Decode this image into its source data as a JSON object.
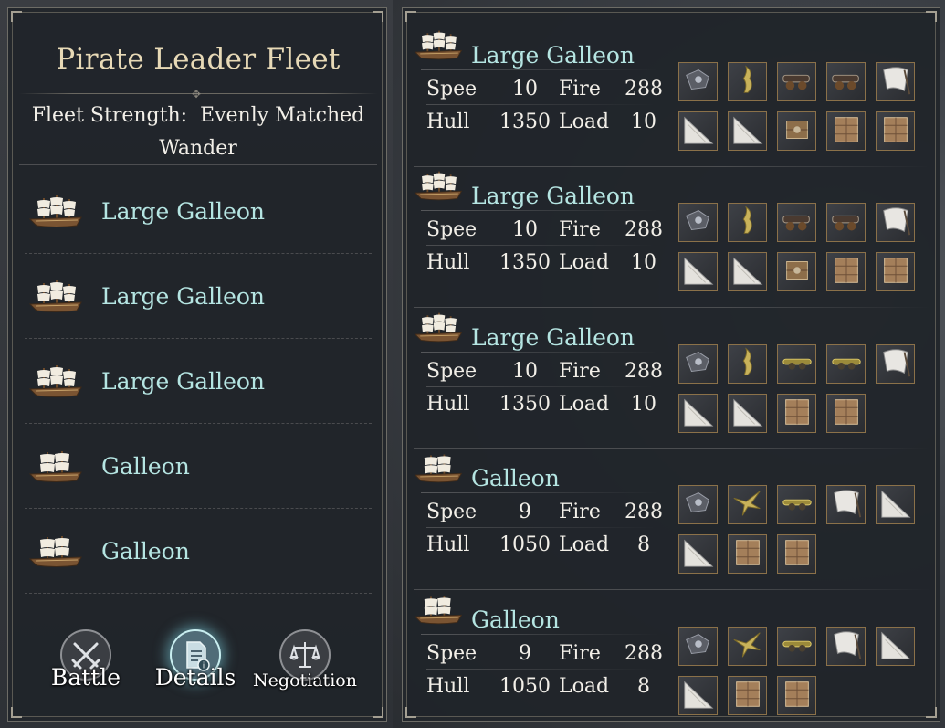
{
  "left": {
    "title": "Pirate Leader Fleet",
    "strength_label": "Fleet Strength:",
    "strength_value": "Evenly Matched",
    "strength_sub": "Wander",
    "ships": [
      {
        "name": "Large Galleon",
        "icon": "large-galleon-icon"
      },
      {
        "name": "Large Galleon",
        "icon": "large-galleon-icon"
      },
      {
        "name": "Large Galleon",
        "icon": "large-galleon-icon"
      },
      {
        "name": "Galleon",
        "icon": "galleon-icon"
      },
      {
        "name": "Galleon",
        "icon": "galleon-icon"
      }
    ],
    "actions": [
      {
        "label": "Battle",
        "icon": "crossed-swords-icon"
      },
      {
        "label": "Details",
        "icon": "document-info-icon",
        "active": true
      },
      {
        "label": "Negotiation",
        "icon": "scales-icon"
      }
    ]
  },
  "details": [
    {
      "name": "Large Galleon",
      "speed_label": "Spee",
      "speed": "10",
      "fire_label": "Fire",
      "fire": "288",
      "hull_label": "Hull",
      "hull": "1350",
      "load_label": "Load",
      "load": "10",
      "equipment": [
        [
          "armor-icon",
          "figurehead-icon",
          "cannon-icon",
          "cannon-icon",
          "sail-icon"
        ],
        [
          "sail-plate-icon",
          "sail-plate-icon",
          "crate-icon",
          "cargo-icon",
          "cargo-icon"
        ]
      ]
    },
    {
      "name": "Large Galleon",
      "speed_label": "Spee",
      "speed": "10",
      "fire_label": "Fire",
      "fire": "288",
      "hull_label": "Hull",
      "hull": "1350",
      "load_label": "Load",
      "load": "10",
      "equipment": [
        [
          "armor-icon",
          "figurehead-icon",
          "cannon-icon",
          "cannon-icon",
          "sail-icon"
        ],
        [
          "sail-plate-icon",
          "sail-plate-icon",
          "crate-icon",
          "cargo-icon",
          "cargo-icon"
        ]
      ]
    },
    {
      "name": "Large Galleon",
      "speed_label": "Spee",
      "speed": "10",
      "fire_label": "Fire",
      "fire": "288",
      "hull_label": "Hull",
      "hull": "1350",
      "load_label": "Load",
      "load": "10",
      "equipment": [
        [
          "armor-icon",
          "figurehead-icon",
          "gold-cannon-icon",
          "gold-cannon-icon",
          "sail-icon"
        ],
        [
          "sail-plate-icon",
          "sail-plate-icon",
          "cargo-icon",
          "cargo-icon"
        ]
      ]
    },
    {
      "name": "Galleon",
      "speed_label": "Spee",
      "speed": "9",
      "fire_label": "Fire",
      "fire": "288",
      "hull_label": "Hull",
      "hull": "1050",
      "load_label": "Load",
      "load": "8",
      "equipment": [
        [
          "armor-icon",
          "eagle-figurehead-icon",
          "gold-cannon-icon",
          "sail-icon",
          "sail-plate-icon"
        ],
        [
          "sail-plate-icon",
          "cargo-icon",
          "cargo-icon"
        ]
      ]
    },
    {
      "name": "Galleon",
      "speed_label": "Spee",
      "speed": "9",
      "fire_label": "Fire",
      "fire": "288",
      "hull_label": "Hull",
      "hull": "1050",
      "load_label": "Load",
      "load": "8",
      "equipment": [
        [
          "armor-icon",
          "eagle-figurehead-icon",
          "gold-cannon-icon",
          "sail-icon",
          "sail-plate-icon"
        ],
        [
          "sail-plate-icon",
          "cargo-icon",
          "cargo-icon"
        ]
      ]
    }
  ],
  "colors": {
    "ship_name": "#b5e5e2",
    "title": "#e7d9b6",
    "slot_border": "#8b7149",
    "active_glow": "#78c8d7"
  }
}
